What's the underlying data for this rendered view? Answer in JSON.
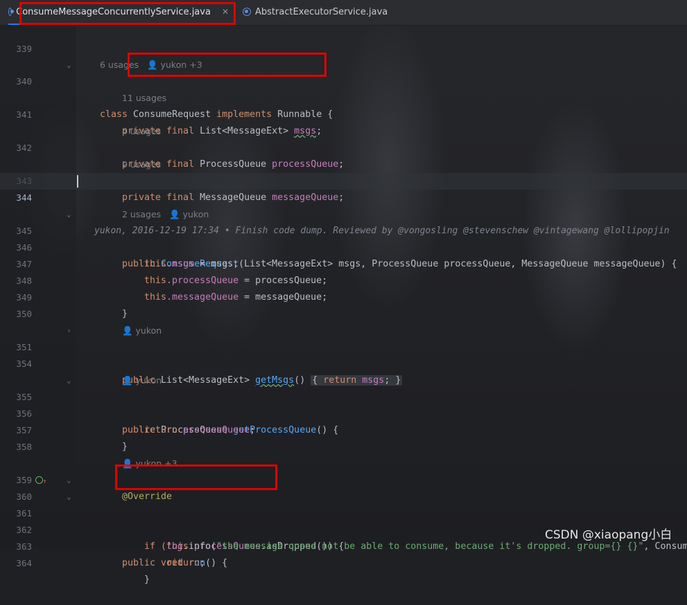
{
  "tabs": [
    {
      "label": "ConsumeMessageConcurrentlyService.java",
      "active": true,
      "icon": "class-icon"
    },
    {
      "label": "AbstractExecutorService.java",
      "active": false,
      "icon": "class-icon"
    }
  ],
  "lines": {
    "l339": "339",
    "l340": "340",
    "l341": "341",
    "l342": "342",
    "l343": "343",
    "l344": "344",
    "l345": "345",
    "l346": "346",
    "l347": "347",
    "l348": "348",
    "l349": "349",
    "l350": "350",
    "l351": "351",
    "l354": "354",
    "l355": "355",
    "l356": "356",
    "l357": "357",
    "l358": "358",
    "l359": "359",
    "l360": "360",
    "l361": "361",
    "l362": "362",
    "l363": "363",
    "l364": "364"
  },
  "hints": {
    "h1": "6 usages   👤 yukon +3",
    "h2": "11 usages",
    "h3": "4 usages",
    "h4": "9 usages",
    "h5": "2 usages   👤 yukon",
    "h6": "👤 yukon",
    "h7": "👤 yukon",
    "h8": "👤 yukon +3"
  },
  "blame": "yukon, 2016-12-19 17:34 • Finish code dump. Reviewed by @vongosling @stevenschew @vintagewang @lollipopjin",
  "code": {
    "c340a": "class ",
    "c340b": "ConsumeRequest",
    "c340c": " implements",
    "c340d": " Runnable {",
    "c341a": "private final ",
    "c341b": "List<MessageExt> ",
    "c341c": "msgs",
    "c341d": ";",
    "c342a": "private final ",
    "c342b": "ProcessQueue ",
    "c342c": "processQueue",
    "c342d": ";",
    "c343a": "private final ",
    "c343b": "MessageQueue ",
    "c343c": "messageQueue",
    "c343d": ";",
    "c345a": "public ",
    "c345b": "ConsumeRequest",
    "c345c": "(List<MessageExt> msgs, ProcessQueue processQueue, MessageQueue messageQueue) {",
    "c346a": "this",
    "c346b": ".msgs",
    "c346c": " = msgs;",
    "c347a": "this",
    "c347b": ".processQueue",
    "c347c": " = processQueue;",
    "c348a": "this",
    "c348b": ".messageQueue",
    "c348c": " = messageQueue;",
    "c349": "}",
    "c351a": "public ",
    "c351b": "List<MessageExt> ",
    "c351c": "getMsgs",
    "c351d": "() ",
    "c351e": "{ ",
    "c351f": "return ",
    "c351g": "msgs",
    "c351h": "; }",
    "c355a": "public ",
    "c355b": "ProcessQueue ",
    "c355c": "getProcessQueue",
    "c355d": "() {",
    "c356a": "return ",
    "c356b": "processQueue",
    "c356c": ";",
    "c357": "}",
    "c359": "@Override",
    "c360a": "public void ",
    "c360b": "run",
    "c360c": "() {",
    "c361a": "if (",
    "c361b": "this",
    "c361c": ".processQueue",
    "c361d": ".isDropped()) {",
    "c362a": "log",
    "c362b": ".info(",
    "c362c": "\"the message queue not be able to consume, because it's dropped. group={} {}\"",
    "c362d": ", Consum",
    "c363a": "return",
    "c363b": ";",
    "c364": "}"
  },
  "watermark": "CSDN @xiaopang小白"
}
